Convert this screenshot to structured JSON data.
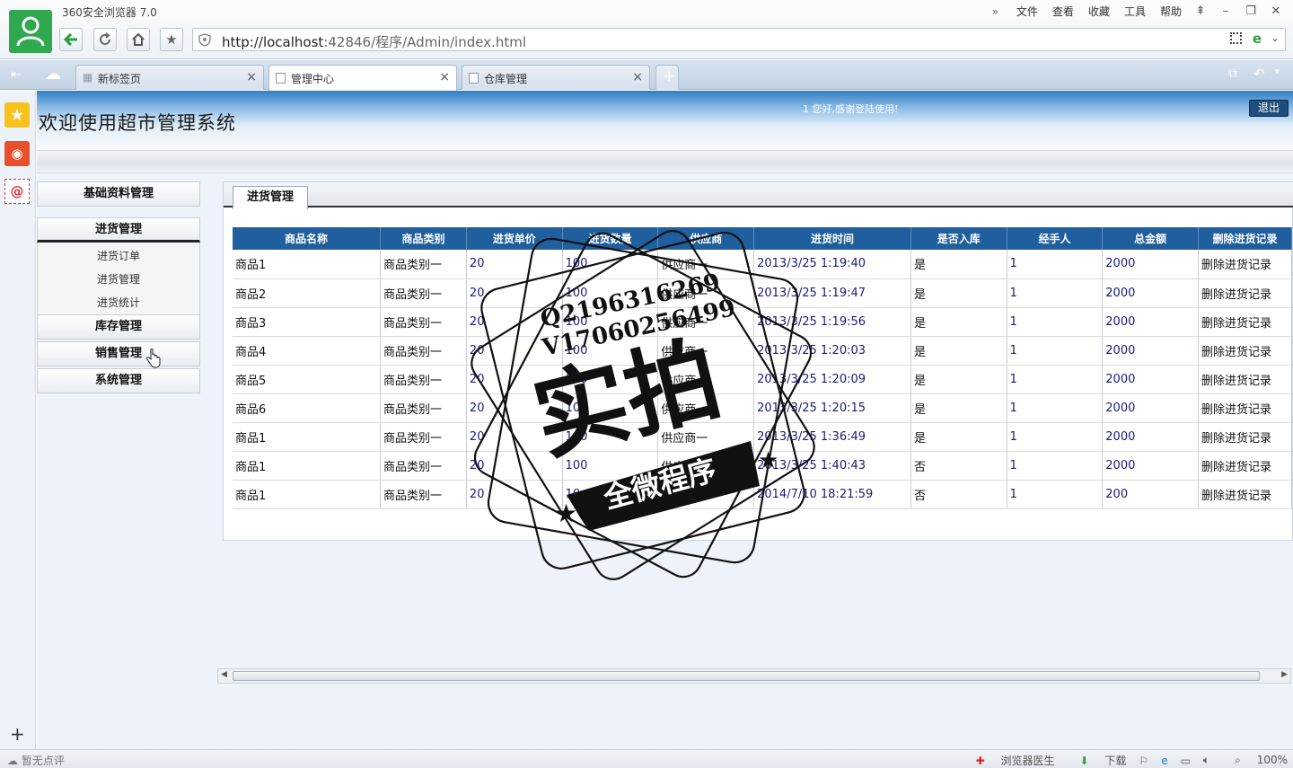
{
  "browser": {
    "app_title": "360安全浏览器 7.0",
    "menu": [
      "文件",
      "查看",
      "收藏",
      "工具",
      "帮助"
    ],
    "url_host": "http://localhost",
    "url_rest": ":42846/程序/Admin/index.html",
    "tabs": [
      {
        "label": "新标签页"
      },
      {
        "label": "管理中心"
      },
      {
        "label": "仓库管理"
      }
    ],
    "status_left": "暂无点评",
    "status_doctor": "浏览器医生",
    "status_download": "下载",
    "zoom": "100%"
  },
  "site": {
    "title": "欢迎使用超市管理系统",
    "welcome": "1 您好,感谢登陆使用!",
    "logout": "退出"
  },
  "nav": {
    "basic": "基础资料管理",
    "purchase": "进货管理",
    "purchase_items": [
      "进货订单",
      "进货管理",
      "进货统计"
    ],
    "stock": "库存管理",
    "sales": "销售管理",
    "system": "系统管理"
  },
  "content": {
    "tab": "进货管理",
    "columns": [
      "商品名称",
      "商品类别",
      "进货单价",
      "进货数量",
      "供应商",
      "进货时间",
      "是否入库",
      "经手人",
      "总金额",
      "删除进货记录"
    ],
    "rows": [
      [
        "商品1",
        "商品类别一",
        "20",
        "100",
        "供应商一",
        "2013/3/25 1:19:40",
        "是",
        "1",
        "2000",
        "删除进货记录"
      ],
      [
        "商品2",
        "商品类别一",
        "20",
        "100",
        "供应商一",
        "2013/3/25 1:19:47",
        "是",
        "1",
        "2000",
        "删除进货记录"
      ],
      [
        "商品3",
        "商品类别一",
        "20",
        "100",
        "供应商一",
        "2013/3/25 1:19:56",
        "是",
        "1",
        "2000",
        "删除进货记录"
      ],
      [
        "商品4",
        "商品类别一",
        "20",
        "100",
        "供应商一",
        "2013/3/25 1:20:03",
        "是",
        "1",
        "2000",
        "删除进货记录"
      ],
      [
        "商品5",
        "商品类别一",
        "20",
        "100",
        "供应商一",
        "2013/3/25 1:20:09",
        "是",
        "1",
        "2000",
        "删除进货记录"
      ],
      [
        "商品6",
        "商品类别一",
        "20",
        "100",
        "供应商一",
        "2013/3/25 1:20:15",
        "是",
        "1",
        "2000",
        "删除进货记录"
      ],
      [
        "商品1",
        "商品类别一",
        "20",
        "100",
        "供应商一",
        "2013/3/25 1:36:49",
        "是",
        "1",
        "2000",
        "删除进货记录"
      ],
      [
        "商品1",
        "商品类别一",
        "20",
        "100",
        "供应商一",
        "2013/3/25 1:40:43",
        "否",
        "1",
        "2000",
        "删除进货记录"
      ],
      [
        "商品1",
        "商品类别一",
        "20",
        "10",
        "供应商一",
        "2014/7/10 18:21:59",
        "否",
        "1",
        "200",
        "删除进货记录"
      ]
    ]
  },
  "watermark": {
    "qq": "Q2196316269",
    "vx": "V17060256499",
    "big": "实拍",
    "banner": "全微程序"
  }
}
